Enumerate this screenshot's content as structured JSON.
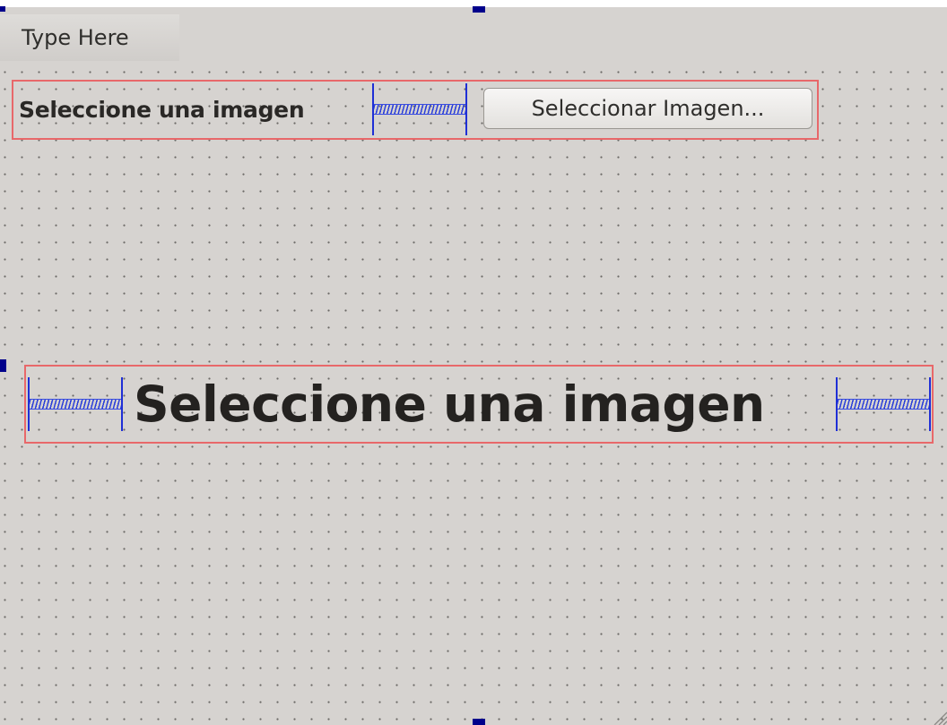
{
  "menu": {
    "type_here": "Type Here"
  },
  "top_row": {
    "label": "Seleccione una imagen",
    "button_label": "Seleccionar Imagen..."
  },
  "big_label": {
    "text": "Seleccione una imagen"
  },
  "colors": {
    "form_background": "#d6d3d0",
    "layout_border": "#e8686a",
    "spacer": "#1f2fd6",
    "selection_handle": "#00008b"
  }
}
